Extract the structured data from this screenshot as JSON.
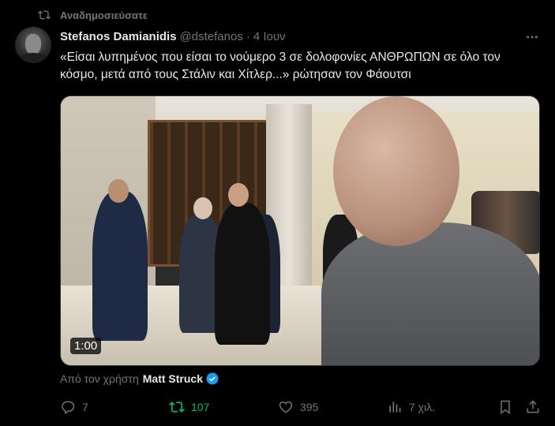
{
  "repost_label": "Αναδημοσιεύσατε",
  "tweet": {
    "author_name": "Stefanos Damianidis",
    "author_handle": "@dstefanos",
    "separator": "·",
    "date": "4 Ιουν",
    "text": "«Είσαι λυπημένος που είσαι το νούμερο 3 σε δολοφονίες ΑΝΘΡΩΠΩΝ σε όλο τον κόσμο, μετά από τους Στάλιν και Χίτλερ...» ρώτησαν τον Φάουτσι"
  },
  "media": {
    "duration": "1:00"
  },
  "source": {
    "prefix": "Από τον χρήστη",
    "name": "Matt Struck"
  },
  "actions": {
    "replies": "7",
    "reposts": "107",
    "likes": "395",
    "views": "7 χιλ."
  },
  "colors": {
    "background": "#000000",
    "text": "#e7e9ea",
    "muted": "#71767b",
    "repost_active": "#00ba7c",
    "verified": "#1d9bf0"
  }
}
